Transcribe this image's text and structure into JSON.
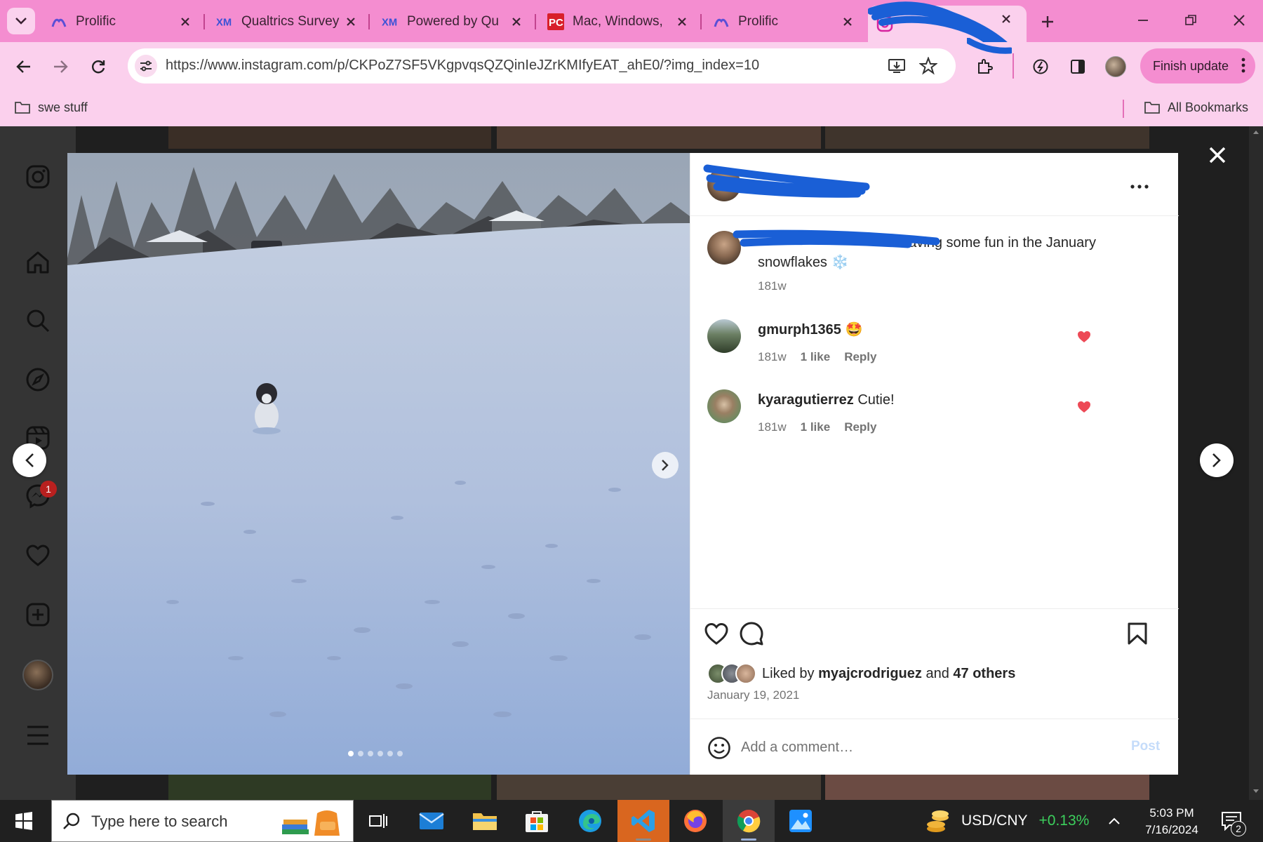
{
  "browser": {
    "tabs": [
      {
        "title": "Prolific",
        "favicon": "prolific-icon"
      },
      {
        "title": "Qualtrics Survey",
        "favicon": "qualtrics-xm-icon"
      },
      {
        "title": "Powered by Qu",
        "favicon": "qualtrics-xm-icon"
      },
      {
        "title": "Mac, Windows,",
        "favicon": "pcmag-icon"
      },
      {
        "title": "Prolific",
        "favicon": "prolific-icon"
      }
    ],
    "active_tab": {
      "favicon": "instagram-icon",
      "title_redacted": true
    },
    "url": "https://www.instagram.com/p/CKPoZ7SF5VKgpvqsQZQinIeJZrKMIfyEAT_ahE0/?img_index=10",
    "finish_update_label": "Finish update",
    "bookmarks": {
      "folder": "swe stuff",
      "all": "All Bookmarks"
    },
    "theme": {
      "tabstrip": "#f48dd0",
      "toolbar": "#fbd0ed"
    }
  },
  "instagram": {
    "sidebar_icons": [
      "instagram-logo-icon",
      "home-icon",
      "search-icon",
      "explore-icon",
      "reels-icon",
      "messages-icon",
      "notifications-heart-icon",
      "create-icon",
      "profile-avatar",
      "menu-icon"
    ],
    "messages_badge": "1",
    "post": {
      "owner_username_redacted": true,
      "caption": {
        "text_visible": "having some fun in the January snowflakes",
        "emoji": "❄️",
        "age": "181w"
      },
      "comments": [
        {
          "username": "gmurph1365",
          "text": "",
          "emoji": "🤩",
          "age": "181w",
          "likes": "1 like",
          "reply": "Reply",
          "liked": true
        },
        {
          "username": "kyaragutierrez",
          "text": "Cutie!",
          "age": "181w",
          "likes": "1 like",
          "reply": "Reply",
          "liked": true
        }
      ],
      "liked_by": {
        "prefix": "Liked by",
        "user": "myajcrodriguez",
        "and": "and",
        "others": "47 others"
      },
      "date": "January 19, 2021",
      "comment_placeholder": "Add a comment…",
      "post_button": "Post",
      "carousel": {
        "count": 6,
        "current": 1
      }
    }
  },
  "taskbar": {
    "search_placeholder": "Type here to search",
    "ticker": {
      "pair": "USD/CNY",
      "change": "+0.13%"
    },
    "clock": {
      "time": "5:03 PM",
      "date": "7/16/2024"
    },
    "notifications": "2",
    "apps": [
      "task-view-icon",
      "mail-icon",
      "file-explorer-icon",
      "microsoft-store-icon",
      "edge-icon",
      "vscode-icon",
      "firefox-icon",
      "chrome-icon",
      "photos-icon"
    ]
  }
}
